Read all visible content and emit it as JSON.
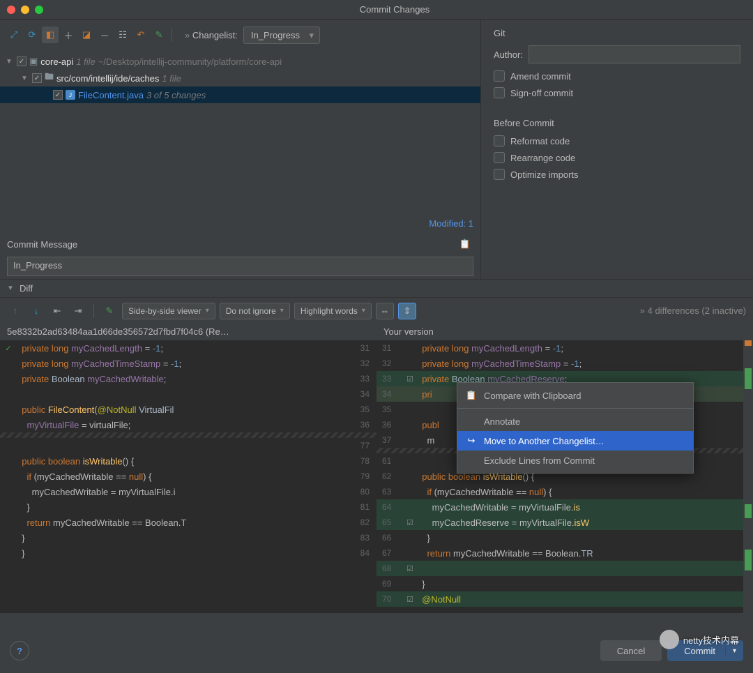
{
  "title": "Commit Changes",
  "toolbar": {
    "changelist_label": "Changelist:",
    "changelist_value": "In_Progress"
  },
  "tree": {
    "root": {
      "name": "core-api",
      "info": "1 file",
      "path": "~/Desktop/intellij-community/platform/core-api"
    },
    "folder": {
      "name": "src/com/intellij/ide/caches",
      "info": "1 file"
    },
    "file": {
      "name": "FileContent.java",
      "info": "3 of 5 changes"
    },
    "status": "Modified: 1"
  },
  "commit_msg": {
    "label": "Commit Message",
    "value": "In_Progress"
  },
  "git": {
    "header": "Git",
    "author_label": "Author:",
    "amend": "Amend commit",
    "signoff": "Sign-off commit"
  },
  "before": {
    "header": "Before Commit",
    "reformat": "Reformat code",
    "rearrange": "Rearrange code",
    "optimize": "Optimize imports"
  },
  "diff": {
    "label": "Diff",
    "viewer": "Side-by-side viewer",
    "ignore": "Do not ignore",
    "highlight": "Highlight words",
    "status": "4 differences (2 inactive)",
    "left_title": "5e8332b2ad63484aa1d66de356572d7fbd7f04c6 (Re…",
    "right_title": "Your version"
  },
  "context_menu": {
    "compare": "Compare with Clipboard",
    "annotate": "Annotate",
    "move": "Move to Another Changelist…",
    "exclude": "Exclude Lines from Commit"
  },
  "buttons": {
    "cancel": "Cancel",
    "commit": "Commit"
  },
  "watermark": "netty技术内幕",
  "code_left": [
    {
      "ln": "31",
      "t": [
        "kw:private ",
        "kw:long ",
        "fld:myCachedLength",
        " = ",
        "num:-1",
        ";"
      ]
    },
    {
      "ln": "32",
      "t": [
        "kw:private ",
        "kw:long ",
        "fld:myCachedTimeStamp",
        " = ",
        "num:-1",
        ";"
      ]
    },
    {
      "ln": "33",
      "t": [
        "kw:private ",
        "ty:Boolean ",
        "fld:myCachedWritable",
        ";"
      ]
    },
    {
      "ln": "34",
      "t": [
        ""
      ]
    },
    {
      "ln": "35",
      "t": [
        "kw:public ",
        "fn:FileContent",
        "(",
        "an:@NotNull ",
        "ty:VirtualFil"
      ]
    },
    {
      "ln": "36",
      "t": [
        "  ",
        "fld:myVirtualFile",
        " = virtualFile;"
      ]
    },
    {
      "ln": "",
      "t": [
        ""
      ],
      "zig": true
    },
    {
      "ln": "77",
      "t": [
        ""
      ]
    },
    {
      "ln": "78",
      "t": [
        "kw:public ",
        "kw:boolean ",
        "fn:isWritable",
        "() {"
      ]
    },
    {
      "ln": "79",
      "t": [
        "  ",
        "kw:if ",
        "(myCachedWritable == ",
        "kw:null",
        ") {"
      ]
    },
    {
      "ln": "80",
      "t": [
        "    myCachedWritable = myVirtualFile.i"
      ]
    },
    {
      "ln": "81",
      "t": [
        "  }"
      ]
    },
    {
      "ln": "82",
      "t": [
        "  ",
        "kw:return ",
        "myCachedWritable == Boolean.",
        "ty:T"
      ]
    },
    {
      "ln": "83",
      "t": [
        "}"
      ]
    },
    {
      "ln": "84",
      "t": [
        "}"
      ]
    }
  ],
  "code_right": [
    {
      "ln": "31",
      "t": [
        "kw:private ",
        "kw:long ",
        "fld:myCachedLength",
        " = ",
        "num:-1",
        ";"
      ]
    },
    {
      "ln": "32",
      "t": [
        "kw:private ",
        "kw:long ",
        "fld:myCachedTimeStamp",
        " = ",
        "num:-1",
        ";"
      ]
    },
    {
      "ln": "33",
      "mk": "☑",
      "hl": "hl-green",
      "t": [
        "kw:private ",
        "ty:Boolean ",
        "fld:myCachedReserve",
        ";"
      ]
    },
    {
      "ln": "34",
      "hl": "hl-dark",
      "t": [
        "kw:pri"
      ]
    },
    {
      "ln": "35",
      "t": [
        ""
      ]
    },
    {
      "ln": "36",
      "t": [
        "kw:publ"
      ]
    },
    {
      "ln": "37",
      "t": [
        "  m"
      ]
    },
    {
      "ln": "",
      "t": [
        ""
      ],
      "zig": true
    },
    {
      "ln": "61",
      "t": [
        ""
      ]
    },
    {
      "ln": "62",
      "t": [
        "kw:public ",
        "kw:boolean ",
        "fn:isWritable",
        "() {"
      ]
    },
    {
      "ln": "63",
      "t": [
        "  ",
        "kw:if ",
        "(myCachedWritable == ",
        "kw:null",
        ") {"
      ]
    },
    {
      "ln": "64",
      "hl": "hl-green",
      "t": [
        "    myCachedWritable = myVirtualFile.",
        "fn:is"
      ]
    },
    {
      "ln": "65",
      "mk": "☑",
      "hl": "hl-green",
      "t": [
        "    myCachedReserve = myVirtualFile.",
        "fn:isW"
      ]
    },
    {
      "ln": "66",
      "t": [
        "  }"
      ]
    },
    {
      "ln": "67",
      "t": [
        "  ",
        "kw:return ",
        "myCachedWritable == Boolean.",
        "ty:TR"
      ]
    },
    {
      "ln": "68",
      "mk": "☑",
      "hl": "hl-green",
      "t": [
        ""
      ]
    },
    {
      "ln": "69",
      "t": [
        "}"
      ]
    },
    {
      "ln": "70",
      "mk": "☑",
      "hl": "hl-green",
      "t": [
        "an:@NotNull"
      ]
    }
  ]
}
